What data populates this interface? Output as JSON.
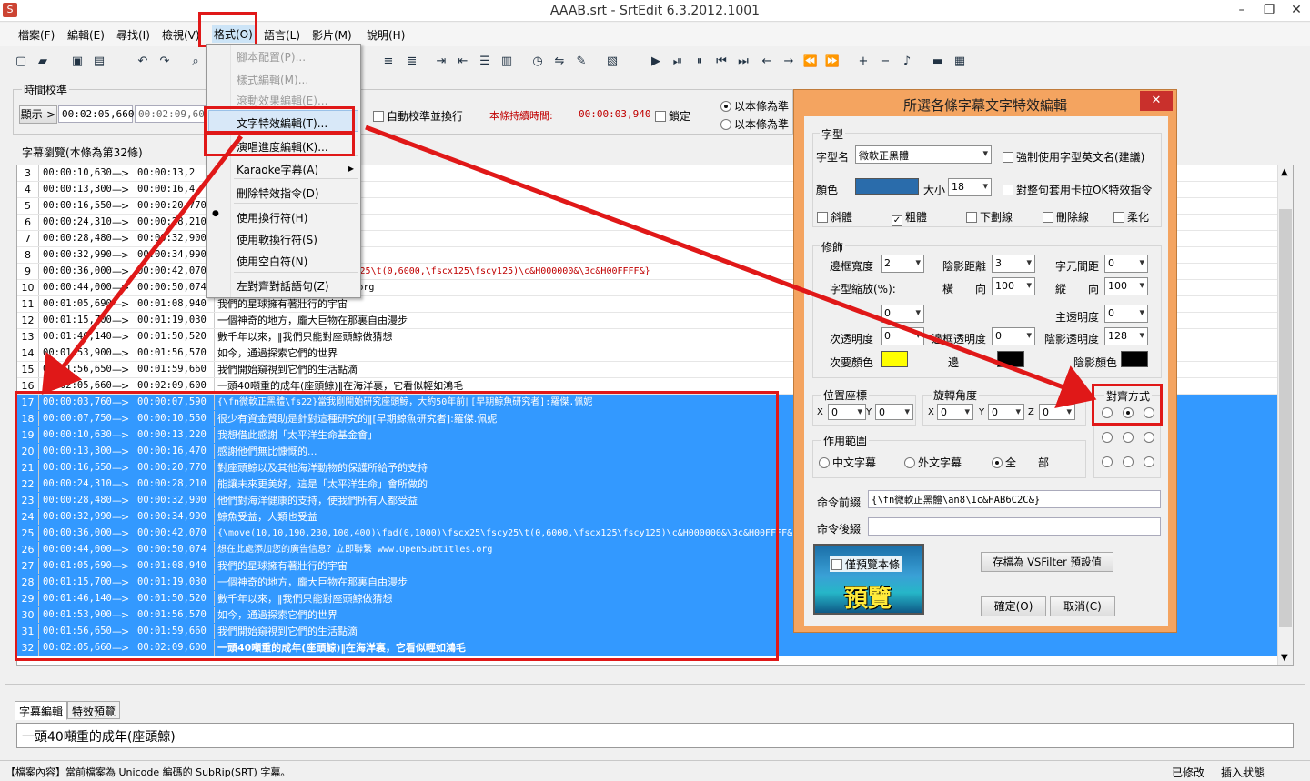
{
  "window": {
    "title": "AAAB.srt - SrtEdit 6.3.2012.1001",
    "minimize": "–",
    "maximize": "❐",
    "close": "✕",
    "icon": "S"
  },
  "menubar": [
    "檔案(F)",
    "編輯(E)",
    "尋找(I)",
    "檢視(V)",
    "格式(O)",
    "語言(L)",
    "影片(M)",
    "說明(H)"
  ],
  "format_menu": {
    "items": [
      {
        "label": "腳本配置(P)...",
        "disabled": true
      },
      {
        "label": "樣式編輯(M)...",
        "disabled": true
      },
      {
        "label": "滾動效果編輯(E)...",
        "disabled": true
      },
      {
        "label": "文字特效編輯(T)...",
        "disabled": false,
        "highlighted": true
      },
      {
        "label": "演唱進度編輯(K)...",
        "disabled": false
      },
      {
        "label": "Karaoke字幕(A)",
        "disabled": false,
        "submenu": true
      },
      {
        "label": "刪除特效指令(D)",
        "disabled": false
      },
      {
        "label": "使用換行符(H)",
        "disabled": false,
        "checked": true
      },
      {
        "label": "使用軟換行符(S)",
        "disabled": false
      },
      {
        "label": "使用空白符(N)",
        "disabled": false
      },
      {
        "label": "左對齊對話語句(Z)",
        "disabled": false
      }
    ],
    "submenu_arrow": "▸",
    "check_mark": "●"
  },
  "time_calibration": {
    "group_title": "時間校準",
    "display_btn": "顯示->",
    "display_time": "00:02:05,660",
    "end_time": "00:02:09,600",
    "auto_calibrate_label": "自動校準並換行",
    "duration_label": "本條持續時間:",
    "duration_value": "00:00:03,940",
    "lock_label": "鎖定",
    "radio_1": "以本條為準",
    "radio_2": "以本條為準"
  },
  "subtitle_browse_title": "字幕瀏覽(本條為第32條)",
  "arrow_text": "—>",
  "rows": [
    {
      "n": "3",
      "s": "00:00:10,630",
      "e": "00:00:13,2",
      "t": "金會」",
      "sel": false
    },
    {
      "n": "4",
      "s": "00:00:13,300",
      "e": "00:00:16,4",
      "t": "",
      "sel": false
    },
    {
      "n": "5",
      "s": "00:00:16,550",
      "e": "00:00:20,770",
      "t": "保護所給予的支持",
      "sel": false
    },
    {
      "n": "6",
      "s": "00:00:24,310",
      "e": "00:00:28,210",
      "t": "洋生命」會所做的",
      "sel": false
    },
    {
      "n": "7",
      "s": "00:00:28,480",
      "e": "00:00:32,900",
      "t": "們所有人都受益",
      "sel": false
    },
    {
      "n": "8",
      "s": "00:00:32,990",
      "e": "00:00:34,990",
      "t": "",
      "sel": false
    },
    {
      "n": "9",
      "s": "00:00:36,000",
      "e": "00:00:42,070",
      "t": "0)\\fad(0,1000)\\fscx25\\fscy25\\t(0,6000,\\fscx125\\fscy125)\\c&H000000&\\3c&H00FFFF&}",
      "sel": false,
      "red": true
    },
    {
      "n": "10",
      "s": "00:00:44,000",
      "e": "00:00:50,074",
      "t": "立即聯繫 www.OpenSubtitles.org",
      "sel": false
    },
    {
      "n": "11",
      "s": "00:01:05,690",
      "e": "00:01:08,940",
      "t": "我們的星球擁有著壯行的宇宙",
      "sel": false
    },
    {
      "n": "12",
      "s": "00:01:15,700",
      "e": "00:01:19,030",
      "t": "一個神奇的地方，龐大巨物在那裏自由漫步",
      "sel": false
    },
    {
      "n": "13",
      "s": "00:01:46,140",
      "e": "00:01:50,520",
      "t": "數千年以來，‖我們只能對座頭鯨做猜想",
      "sel": false
    },
    {
      "n": "14",
      "s": "00:01:53,900",
      "e": "00:01:56,570",
      "t": "如今，通過探索它們的世界",
      "sel": false
    },
    {
      "n": "15",
      "s": "00:01:56,650",
      "e": "00:01:59,660",
      "t": "我們開始窺視到它們的生活點滴",
      "sel": false
    },
    {
      "n": "16",
      "s": "00:02:05,660",
      "e": "00:02:09,600",
      "t": "一頭40噸重的成年(座頭鯨)‖在海洋裏，它看似輕如鴻毛",
      "sel": false
    },
    {
      "n": "17",
      "s": "00:00:03,760",
      "e": "00:00:07,590",
      "t": "{\\fn微軟正黑體\\fs22}當我剛開始研究座頭鯨，大約50年前‖[早期鯨魚研究者]:羅傑.佩妮",
      "sel": true
    },
    {
      "n": "18",
      "s": "00:00:07,750",
      "e": "00:00:10,550",
      "t": "很少有資金贊助是針對這種研究的‖[早期鯨魚研究者]:羅傑.佩妮",
      "sel": true
    },
    {
      "n": "19",
      "s": "00:00:10,630",
      "e": "00:00:13,220",
      "t": "我想借此感謝「太平洋生命基金會」",
      "sel": true
    },
    {
      "n": "20",
      "s": "00:00:13,300",
      "e": "00:00:16,470",
      "t": "感謝他們無比慷慨的...",
      "sel": true
    },
    {
      "n": "21",
      "s": "00:00:16,550",
      "e": "00:00:20,770",
      "t": "對座頭鯨以及其他海洋動物的保護所給予的支持",
      "sel": true
    },
    {
      "n": "22",
      "s": "00:00:24,310",
      "e": "00:00:28,210",
      "t": "能讓未來更美好，這是「太平洋生命」會所做的",
      "sel": true
    },
    {
      "n": "23",
      "s": "00:00:28,480",
      "e": "00:00:32,900",
      "t": "他們對海洋健康的支持，使我們所有人都受益",
      "sel": true
    },
    {
      "n": "24",
      "s": "00:00:32,990",
      "e": "00:00:34,990",
      "t": "鯨魚受益，人類也受益",
      "sel": true
    },
    {
      "n": "25",
      "s": "00:00:36,000",
      "e": "00:00:42,070",
      "t": "{\\move(10,10,190,230,100,400)\\fad(0,1000)\\fscx25\\fscy25\\t(0,6000,\\fscx125\\fscy125)\\c&H000000&\\3c&H00FFFF&}",
      "sel": true
    },
    {
      "n": "26",
      "s": "00:00:44,000",
      "e": "00:00:50,074",
      "t": "想在此處添加您的廣告信息？立即聯繫 www.OpenSubtitles.org",
      "sel": true
    },
    {
      "n": "27",
      "s": "00:01:05,690",
      "e": "00:01:08,940",
      "t": "我們的星球擁有著壯行的宇宙",
      "sel": true
    },
    {
      "n": "28",
      "s": "00:01:15,700",
      "e": "00:01:19,030",
      "t": "一個神奇的地方，龐大巨物在那裏自由漫步",
      "sel": true
    },
    {
      "n": "29",
      "s": "00:01:46,140",
      "e": "00:01:50,520",
      "t": "數千年以來，‖我們只能對座頭鯨做猜想",
      "sel": true
    },
    {
      "n": "30",
      "s": "00:01:53,900",
      "e": "00:01:56,570",
      "t": "如今，通過探索它們的世界",
      "sel": true
    },
    {
      "n": "31",
      "s": "00:01:56,650",
      "e": "00:01:59,660",
      "t": "我們開始窺視到它們的生活點滴",
      "sel": true
    },
    {
      "n": "32",
      "s": "00:02:05,660",
      "e": "00:02:09,600",
      "t": "一頭40噸重的成年(座頭鯨)‖在海洋裏，它看似輕如鴻毛",
      "sel": true,
      "bold": true
    }
  ],
  "dialog": {
    "title": "所選各條字幕文字特效編輯",
    "close": "✕",
    "font_group": "字型",
    "font_name_label": "字型名",
    "font_name": "微軟正黑體",
    "force_english_label": "強制使用字型英文名(建議)",
    "color_label": "顏色",
    "size_label": "大小",
    "size_value": "18",
    "karaoke_label": "對整句套用卡拉OK特效指令",
    "italic_label": "斜體",
    "bold_label": "粗體",
    "underline_label": "下劃線",
    "strike_label": "刪除線",
    "soft_label": "柔化",
    "check_mark": "✓",
    "decor_group": "修飾",
    "border_width_label": "邊框寬度",
    "border_width": "2",
    "shadow_dist_label": "陰影距離",
    "shadow_dist": "3",
    "char_spacing_label": "字元間距",
    "char_spacing": "0",
    "scale_label": "字型縮放(%):",
    "horiz_label": "橫　　向",
    "horiz": "100",
    "vert_label": "縱　　向",
    "vert": "100",
    "rotate_label": "",
    "rotate_val": "0",
    "main_alpha_label": "主透明度",
    "main_alpha": "0",
    "sec_alpha_label": "次透明度",
    "sec_alpha": "0",
    "border_alpha_label": "邊框透明度",
    "border_alpha": "0",
    "shadow_alpha_label": "陰影透明度",
    "shadow_alpha": "128",
    "sec_color_label": "次要顏色",
    "border_color_label": "邊",
    "shadow_color_label": "陰影顏色",
    "pos_group": "位置座標",
    "pos_x_label": "X",
    "pos_x": "0",
    "pos_y_label": "Y",
    "pos_y": "0",
    "rot_group": "旋轉角度",
    "rot_x_label": "X",
    "rot_x": "0",
    "rot_y_label": "Y",
    "rot_y": "0",
    "rot_z_label": "Z",
    "rot_z": "0",
    "align_group": "對齊方式",
    "scope_group": "作用範圍",
    "scope_cn": "中文字幕",
    "scope_foreign": "外文字幕",
    "scope_all": "全　　部",
    "prefix_label": "命令前綴",
    "prefix_value": "{\\fn微軟正黑體\\an8\\1c&HAB6C2C&}",
    "suffix_label": "命令後綴",
    "suffix_value": "",
    "preview_only_label": "僅預覽本條",
    "preview_text": "預覽",
    "save_default_btn": "存檔為 VSFilter 預設值",
    "ok_btn": "確定(O)",
    "cancel_btn": "取消(C)"
  },
  "colors": {
    "font_color": "#2a6cab",
    "secondary": "#ffff00",
    "border": "#000000",
    "shadow": "#000000",
    "selection": "#3399ff",
    "annot": "#e01818",
    "dialog_frame": "#f4a460"
  },
  "bottom": {
    "tab_edit": "字幕編輯",
    "tab_preview": "特效預覽",
    "edit_text": "一頭40噸重的成年(座頭鯨)"
  },
  "status": {
    "left": "【檔案內容】當前檔案為 Unicode 編碼的 SubRip(SRT) 字幕。",
    "modified": "已修改",
    "insert_mode": "插入狀態"
  }
}
